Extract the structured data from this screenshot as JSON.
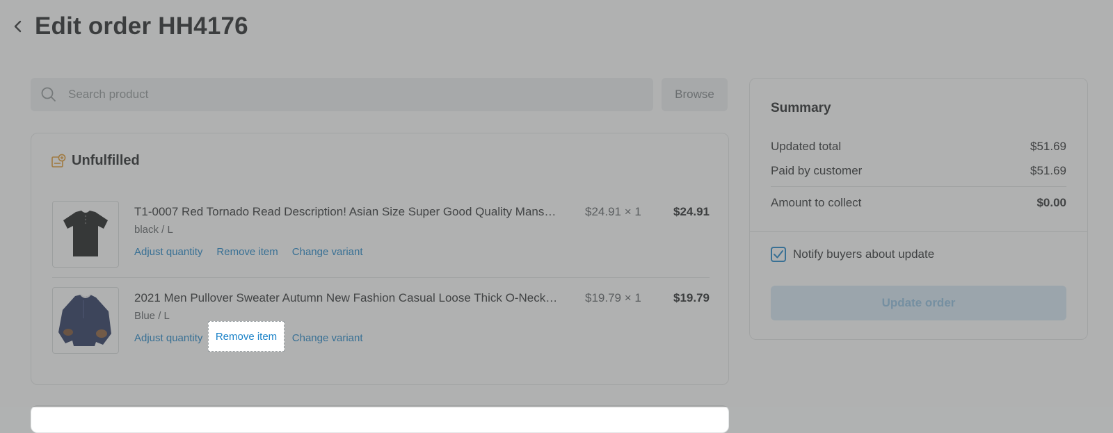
{
  "header": {
    "title": "Edit order HH4176"
  },
  "search": {
    "placeholder": "Search product",
    "browse_label": "Browse"
  },
  "unfulfilled": {
    "title": "Unfulfilled",
    "items": [
      {
        "name": "T1-0007 Red Tornado Read Description! Asian Size Super Good Quality Mans…",
        "variant": "black / L",
        "unit_price": "$24.91 × 1",
        "total": "$24.91",
        "actions": [
          "Adjust quantity",
          "Remove item",
          "Change variant"
        ]
      },
      {
        "name": "2021 Men Pullover Sweater Autumn New Fashion Casual Loose Thick O-Neck…",
        "variant": "Blue / L",
        "unit_price": "$19.79 × 1",
        "total": "$19.79",
        "actions": [
          "Adjust quantity",
          "Remove item",
          "Change variant"
        ]
      }
    ]
  },
  "summary": {
    "title": "Summary",
    "rows": [
      {
        "label": "Updated total",
        "value": "$51.69"
      },
      {
        "label": "Paid by customer",
        "value": "$51.69"
      },
      {
        "label": "Amount to collect",
        "value": "$0.00"
      }
    ],
    "notify_label": "Notify buyers about update",
    "notify_checked": true,
    "update_button": "Update order"
  },
  "colors": {
    "accent": "#1a82c8",
    "icon_orange": "#e0962a"
  }
}
